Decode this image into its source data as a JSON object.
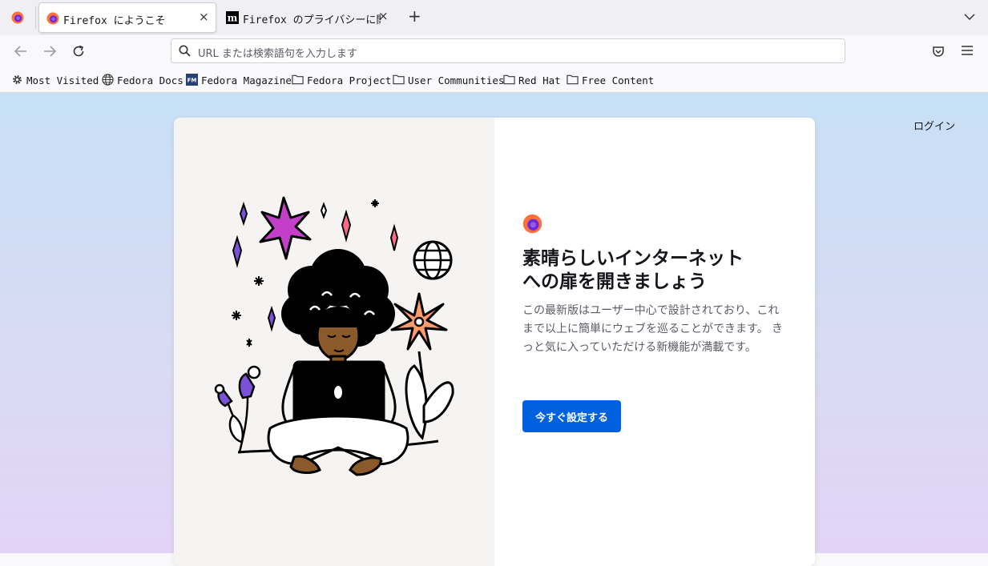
{
  "browser": {
    "tabs": [
      {
        "title": "Firefox にようこそ",
        "active": true
      },
      {
        "title": "Firefox のプライバシーに関",
        "active": false
      }
    ],
    "new_tab_symbol": "+",
    "tab_close_symbol": "×",
    "urlbar_placeholder": "URL または検索語句を入力します",
    "icons": [
      "firefox-icon",
      "back-icon",
      "forward-icon",
      "reload-icon",
      "search-icon",
      "pocket-icon",
      "menu-icon",
      "list-all-tabs-icon"
    ]
  },
  "bookmarks": [
    {
      "label": "Most Visited",
      "icon": "gear-icon"
    },
    {
      "label": "Fedora Docs",
      "icon": "globe-icon"
    },
    {
      "label": "Fedora Magazine",
      "icon": "fm-icon"
    },
    {
      "label": "Fedora Project",
      "icon": "folder-icon"
    },
    {
      "label": "User Communities",
      "icon": "folder-icon"
    },
    {
      "label": "Red Hat",
      "icon": "folder-icon"
    },
    {
      "label": "Free Content",
      "icon": "folder-icon"
    }
  ],
  "page": {
    "login_label": "ログイン",
    "heading_line1": "素晴らしいインターネット",
    "heading_line2": "への扉を開きましょう",
    "description": "この最新版はユーザー中心で設計されており、これまで以上に簡単にウェブを巡ることができます。 きっと気に入っていただける新機能が満載です。",
    "cta_label": "今すぐ設定する"
  },
  "colors": {
    "accent_button": "#0061e0",
    "bg_gradient_top": "#c7e0f5",
    "bg_gradient_bottom": "#e3d4f5"
  }
}
